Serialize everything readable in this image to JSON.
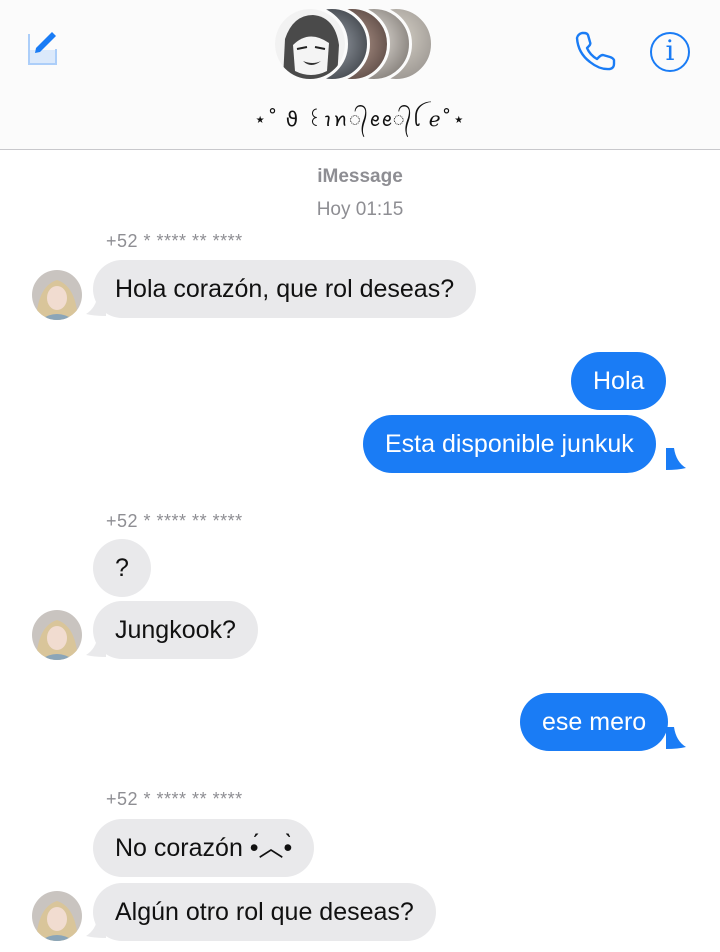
{
  "header": {
    "group_name": "⋆˚ ϑ ꒰ꪱꪀ᭄ꫀꫀ᭄ꪶ ℯ˚⋆",
    "info_label": "i",
    "avatars": [
      "anime-boy",
      "person-2",
      "person-3",
      "person-4",
      "blonde-person"
    ]
  },
  "meta": {
    "service": "iMessage",
    "timestamp": "Hoy 01:15"
  },
  "senders": {
    "s1": "+52 * **** ** ****",
    "s2": "+52 * **** ** ****",
    "s3": "+52 * **** ** ****"
  },
  "messages": {
    "m1": "Hola corazón, que rol deseas?",
    "m2": "Hola",
    "m3": "Esta disponible junkuk",
    "m4": "?",
    "m5": "Jungkook?",
    "m6": "ese mero",
    "m7": "No corazón •́︿•̀",
    "m8": "Algún otro rol que deseas?"
  },
  "colors": {
    "accent": "#1a7cf5",
    "incoming_bubble": "#e9e9eb",
    "meta_text": "#8e8e93"
  }
}
